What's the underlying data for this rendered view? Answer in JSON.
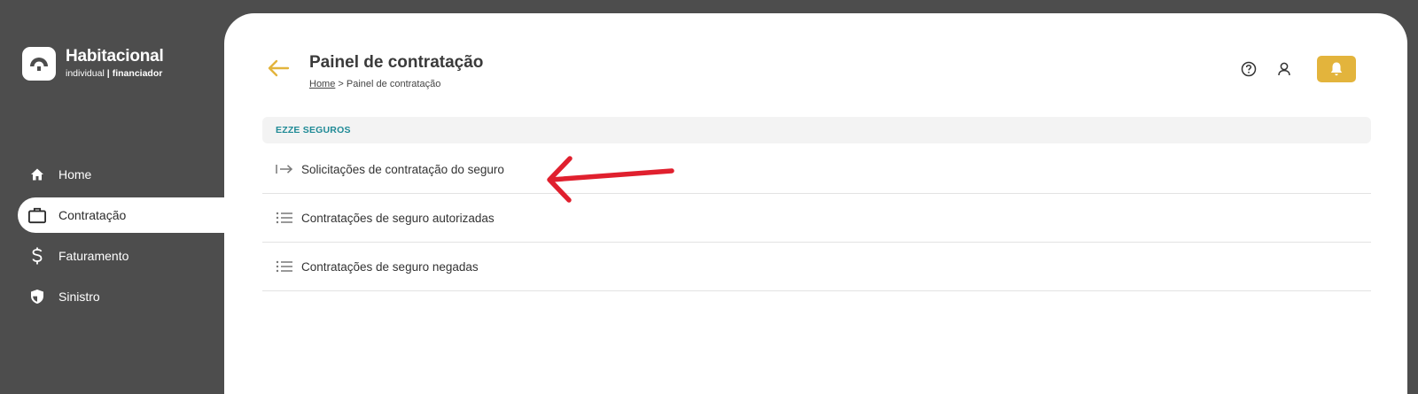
{
  "brand": {
    "title": "Habitacional",
    "sub_left": "individual",
    "sub_sep": "|",
    "sub_right": "financiador"
  },
  "sidebar": {
    "items": [
      {
        "label": "Home",
        "icon": "home-icon",
        "active": false
      },
      {
        "label": "Contratação",
        "icon": "briefcase-icon",
        "active": true
      },
      {
        "label": "Faturamento",
        "icon": "dollar-icon",
        "active": false
      },
      {
        "label": "Sinistro",
        "icon": "shield-icon",
        "active": false
      }
    ]
  },
  "header": {
    "title": "Painel de contratação",
    "breadcrumb_home": "Home",
    "breadcrumb_sep": ">",
    "breadcrumb_current": "Painel de contratação"
  },
  "section": {
    "title": "EZZE SEGUROS",
    "items": [
      {
        "label": "Solicitações de contratação do seguro",
        "icon": "arrow-right-to-line-icon"
      },
      {
        "label": "Contratações de seguro autorizadas",
        "icon": "list-icon"
      },
      {
        "label": "Contratações de seguro negadas",
        "icon": "list-icon"
      }
    ]
  },
  "colors": {
    "sidebar_bg": "#4d4d4d",
    "accent_yellow": "#e3b43c",
    "section_title": "#1f8a96",
    "annotation_red": "#e0202e"
  }
}
